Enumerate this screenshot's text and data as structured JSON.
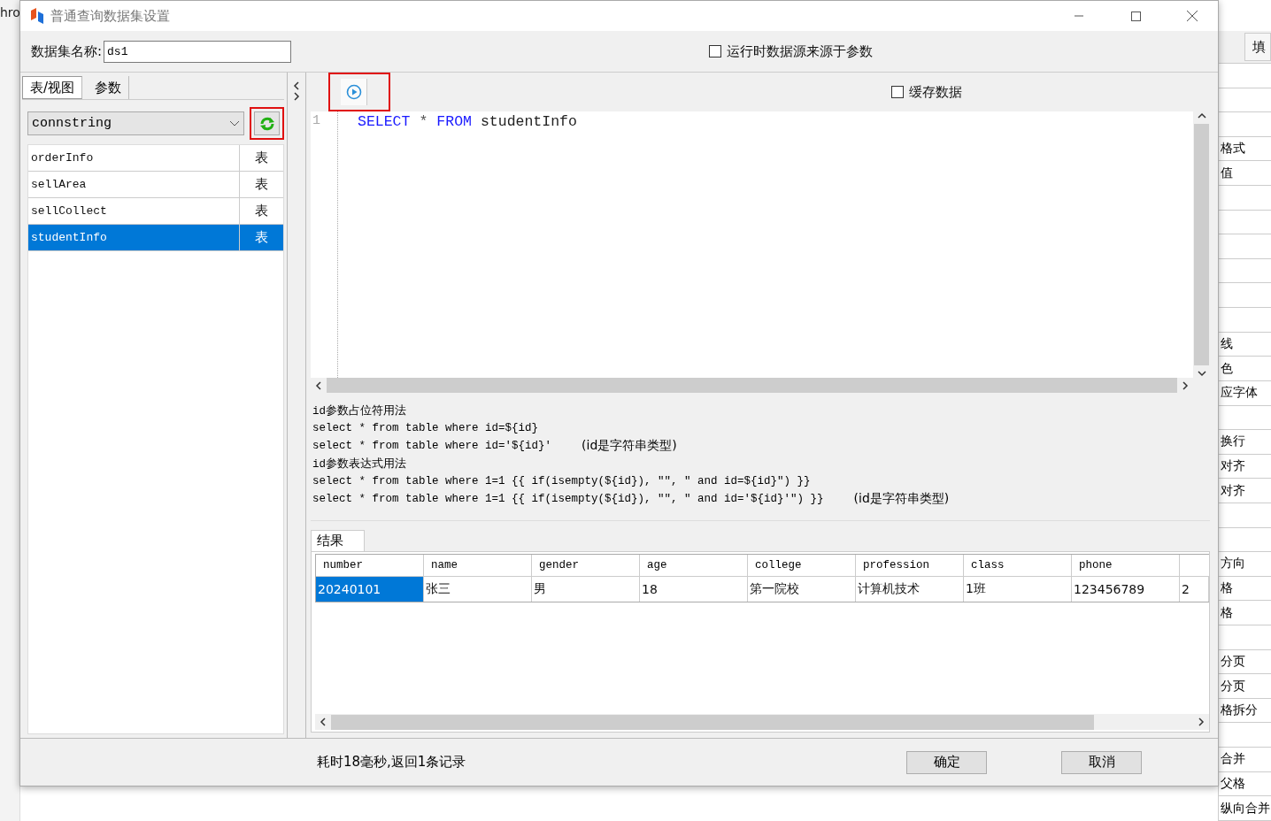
{
  "background": {
    "left_title": "hro",
    "header_button": "填",
    "properties": [
      {
        "kind": "blank"
      },
      {
        "kind": "blank"
      },
      {
        "kind": "blank"
      },
      {
        "kind": "label",
        "text": "格式"
      },
      {
        "kind": "label",
        "text": "值"
      },
      {
        "kind": "blank"
      },
      {
        "kind": "blank"
      },
      {
        "kind": "blank"
      },
      {
        "kind": "blank"
      },
      {
        "kind": "blank"
      },
      {
        "kind": "blank"
      },
      {
        "kind": "label",
        "text": "线"
      },
      {
        "kind": "label",
        "text": "色"
      },
      {
        "kind": "label",
        "text": "应字体"
      },
      {
        "kind": "blank"
      },
      {
        "kind": "label",
        "text": "换行"
      },
      {
        "kind": "label",
        "text": "对齐"
      },
      {
        "kind": "label",
        "text": "对齐"
      },
      {
        "kind": "blank"
      },
      {
        "kind": "blank"
      },
      {
        "kind": "label",
        "text": "方向"
      },
      {
        "kind": "label",
        "text": "格"
      },
      {
        "kind": "label",
        "text": "格"
      },
      {
        "kind": "blank"
      },
      {
        "kind": "label",
        "text": "分页"
      },
      {
        "kind": "label",
        "text": "分页"
      },
      {
        "kind": "label",
        "text": "格拆分"
      },
      {
        "kind": "blank"
      },
      {
        "kind": "label",
        "text": "合并"
      },
      {
        "kind": "label",
        "text": "父格"
      },
      {
        "kind": "label",
        "text": "纵向合并"
      }
    ]
  },
  "window": {
    "title": "普通查询数据集设置"
  },
  "dataset_name": {
    "label": "数据集名称:",
    "value": "ds1"
  },
  "runtime_source": {
    "label": "运行时数据源来源于参数",
    "checked": false
  },
  "left_tabs": [
    {
      "label": "表/视图",
      "selected": true
    },
    {
      "label": "参数",
      "selected": false
    }
  ],
  "connection": {
    "value": "connstring",
    "refresh_highlighted": true
  },
  "tables": [
    {
      "name": "orderInfo",
      "type": "表",
      "selected": false
    },
    {
      "name": "sellArea",
      "type": "表",
      "selected": false
    },
    {
      "name": "sellCollect",
      "type": "表",
      "selected": false
    },
    {
      "name": "studentInfo",
      "type": "表",
      "selected": true
    }
  ],
  "toolbar": {
    "run_highlighted": true,
    "cache": {
      "label": "缓存数据",
      "checked": false
    }
  },
  "editor": {
    "lines": [
      {
        "number": "1",
        "tokens": [
          {
            "text": "SELECT",
            "kind": "keyword"
          },
          {
            "text": "*",
            "kind": "operator"
          },
          {
            "text": "FROM",
            "kind": "keyword"
          },
          {
            "text": "studentInfo",
            "kind": "plain"
          }
        ]
      }
    ]
  },
  "help": [
    {
      "text": "id参数占位符用法"
    },
    {
      "text": "select * from table where id=${id}"
    },
    {
      "text": "select * from table where id='${id}'",
      "note": "(id是字符串类型)"
    },
    {
      "text": "id参数表达式用法"
    },
    {
      "text": "select * from table where 1=1 {{ if(isempty(${id}), \"\", \" and id=${id}\") }}"
    },
    {
      "text": "select * from table where 1=1 {{ if(isempty(${id}), \"\", \" and id='${id}'\") }}",
      "note": "(id是字符串类型)"
    }
  ],
  "results": {
    "tab": "结果",
    "columns": [
      "number",
      "name",
      "gender",
      "age",
      "college",
      "profession",
      "class",
      "phone"
    ],
    "rows": [
      {
        "cells": [
          {
            "text": "20240101",
            "selected": true
          },
          {
            "text": "张三",
            "selected": false
          },
          {
            "text": "男",
            "selected": false
          },
          {
            "text": "18",
            "selected": false
          },
          {
            "text": "第一院校",
            "selected": false
          },
          {
            "text": "计算机技术",
            "selected": false
          },
          {
            "text": "1班",
            "selected": false
          },
          {
            "text": "123456789",
            "selected": false
          },
          {
            "text": "2",
            "selected": false
          }
        ]
      }
    ]
  },
  "status": "耗时18毫秒,返回1条记录",
  "buttons": [
    {
      "label": "确定"
    },
    {
      "label": "取消"
    }
  ]
}
